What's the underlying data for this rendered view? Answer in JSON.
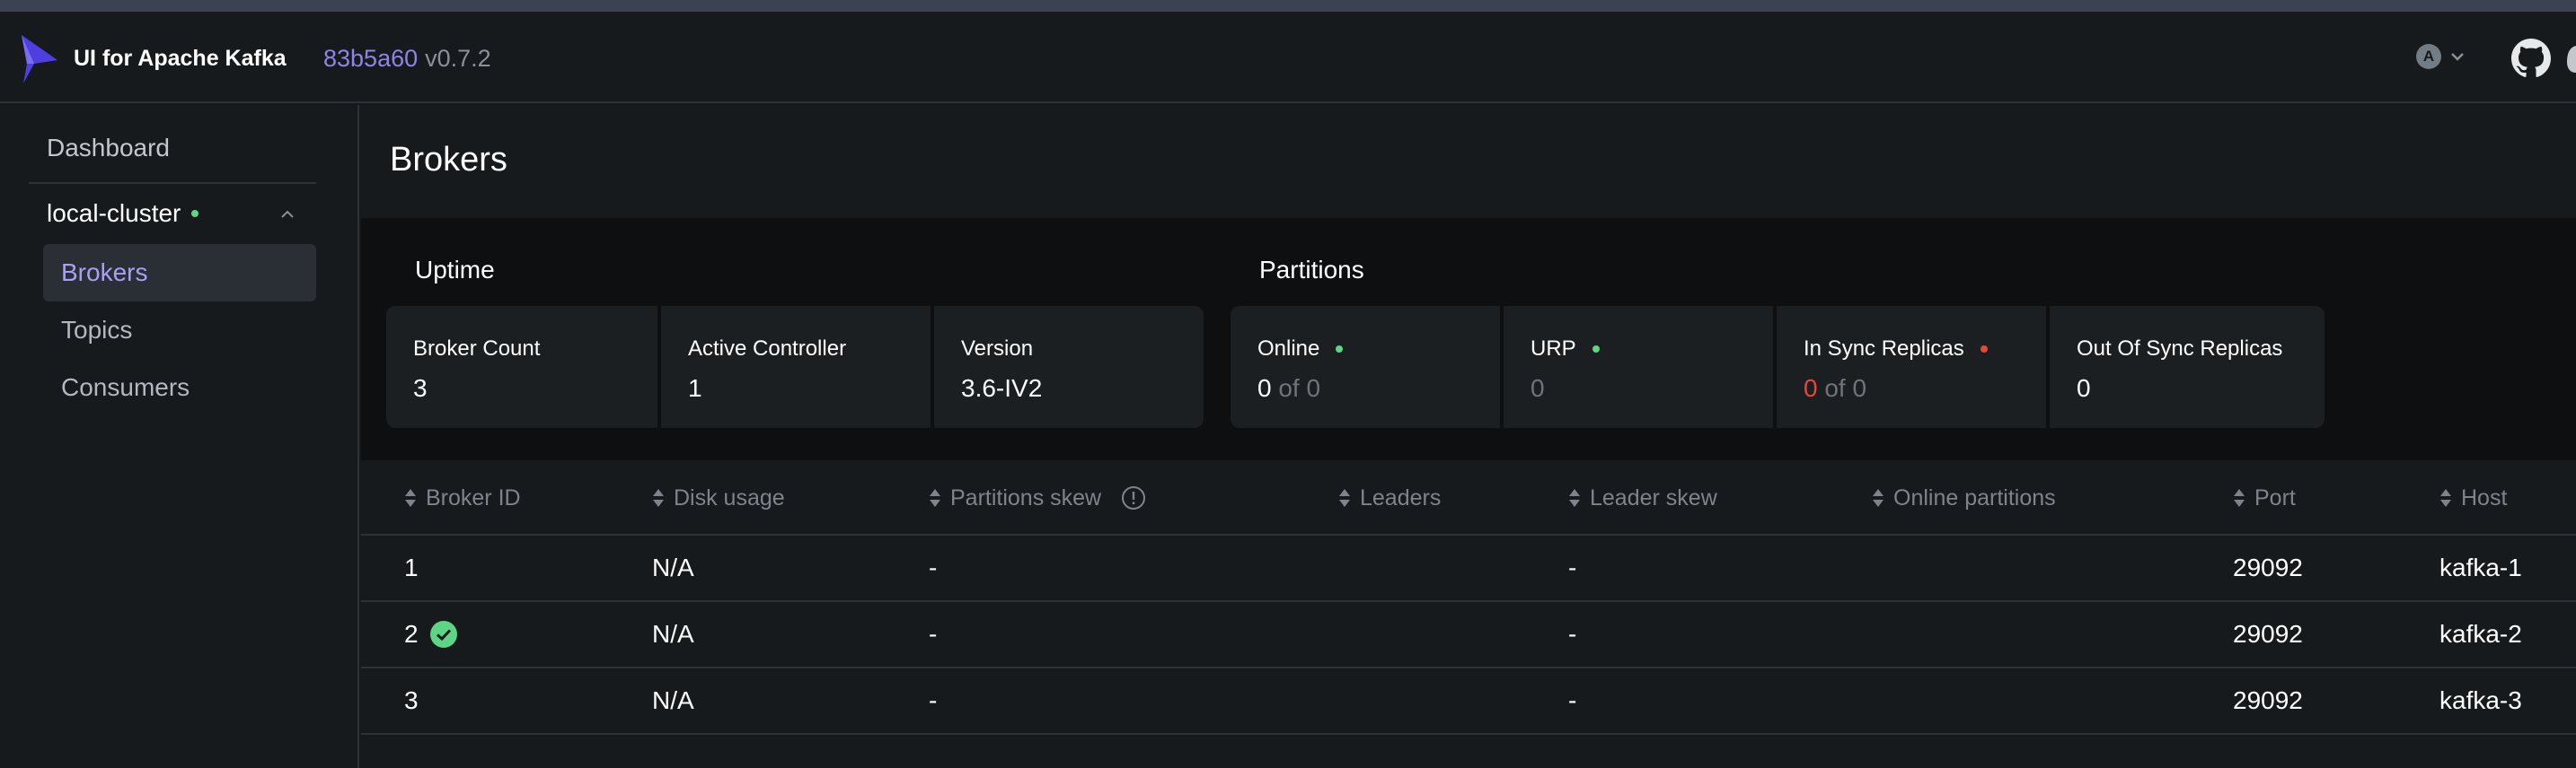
{
  "app": {
    "title": "UI for Apache Kafka",
    "commit": "83b5a60",
    "version": "v0.7.2",
    "account_initial": "A"
  },
  "sidebar": {
    "dashboard": "Dashboard",
    "cluster": {
      "name": "local-cluster",
      "status": "online"
    },
    "items": [
      {
        "label": "Brokers",
        "active": true
      },
      {
        "label": "Topics",
        "active": false
      },
      {
        "label": "Consumers",
        "active": false
      }
    ]
  },
  "page": {
    "title": "Brokers"
  },
  "uptime": {
    "title": "Uptime",
    "cards": [
      {
        "label": "Broker Count",
        "value": "3"
      },
      {
        "label": "Active Controller",
        "value": "1"
      },
      {
        "label": "Version",
        "value": "3.6-IV2"
      }
    ]
  },
  "partitions": {
    "title": "Partitions",
    "online": {
      "label": "Online",
      "value": "0",
      "of": "of 0"
    },
    "urp": {
      "label": "URP",
      "value": "0"
    },
    "in_sync": {
      "label": "In Sync Replicas",
      "value": "0",
      "of": "of 0"
    },
    "out_of_sync": {
      "label": "Out Of Sync Replicas",
      "value": "0"
    }
  },
  "table": {
    "headers": {
      "broker_id": "Broker ID",
      "disk_usage": "Disk usage",
      "partitions_skew": "Partitions skew",
      "leaders": "Leaders",
      "leader_skew": "Leader skew",
      "online_partitions": "Online partitions",
      "port": "Port",
      "host": "Host"
    },
    "rows": [
      {
        "id": "1",
        "controller": false,
        "disk": "N/A",
        "pskew": "-",
        "leaders": "",
        "lskew": "-",
        "online": "",
        "port": "29092",
        "host": "kafka-1"
      },
      {
        "id": "2",
        "controller": true,
        "disk": "N/A",
        "pskew": "-",
        "leaders": "",
        "lskew": "-",
        "online": "",
        "port": "29092",
        "host": "kafka-2"
      },
      {
        "id": "3",
        "controller": false,
        "disk": "N/A",
        "pskew": "-",
        "leaders": "",
        "lskew": "-",
        "online": "",
        "port": "29092",
        "host": "kafka-3"
      }
    ]
  },
  "colors": {
    "accent": "#8e84e8",
    "status_green": "#5cd685",
    "status_red": "#e5483a",
    "background": "#171a1c"
  },
  "icons": [
    "kafka-logo-icon",
    "account-avatar-icon",
    "chevron-down-icon",
    "github-icon",
    "chevron-up-icon",
    "sort-icon",
    "info-icon",
    "check-circle-icon"
  ]
}
